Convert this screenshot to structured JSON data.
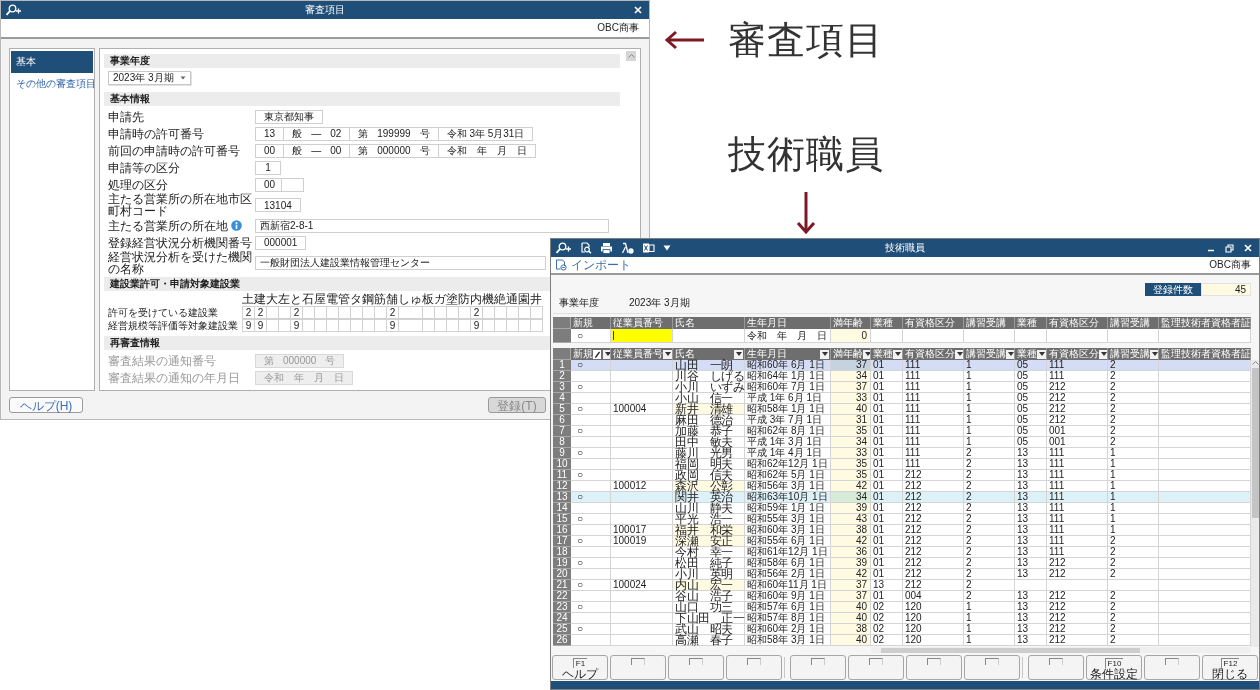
{
  "review_dialog": {
    "title": "審査項目",
    "company": "OBC商事",
    "nav": [
      {
        "label": "基本",
        "selected": true
      },
      {
        "label": "その他の審査項目",
        "selected": false
      }
    ],
    "sections": [
      {
        "kind": "year",
        "title": "事業年度",
        "value": "2023年 3月期"
      },
      {
        "kind": "form",
        "title": "基本情報",
        "disabled": false,
        "rows": [
          {
            "label": "申請先",
            "fields": [
              {
                "kind": "text",
                "parts": [
                  "東京都知事"
                ]
              }
            ]
          },
          {
            "label": "申請時の許可番号",
            "fields": [
              {
                "kind": "text",
                "parts": [
                  "13"
                ]
              },
              {
                "kind": "text",
                "parts": [
                  "般",
                  "—",
                  "02"
                ]
              },
              {
                "kind": "text",
                "parts": [
                  "第",
                  "199999",
                  "号"
                ]
              },
              {
                "kind": "text",
                "parts": [
                  "令和 3年 5月31日"
                ]
              }
            ]
          },
          {
            "label": "前回の申請時の許可番号",
            "fields": [
              {
                "kind": "text",
                "parts": [
                  "00"
                ]
              },
              {
                "kind": "text",
                "parts": [
                  "般",
                  "—",
                  "00"
                ]
              },
              {
                "kind": "text",
                "parts": [
                  "第",
                  "000000",
                  "号"
                ]
              },
              {
                "kind": "text",
                "parts": [
                  "令和　年　月　日"
                ]
              }
            ]
          },
          {
            "label": "申請等の区分",
            "fields": [
              {
                "kind": "text",
                "parts": [
                  "1"
                ]
              }
            ]
          },
          {
            "label": "処理の区分",
            "fields": [
              {
                "kind": "pair",
                "parts": [
                  "00"
                ]
              }
            ]
          },
          {
            "label": "主たる営業所の所在地市区町村コード",
            "fields": [
              {
                "kind": "text",
                "parts": [
                  "13104"
                ]
              }
            ]
          },
          {
            "label": "主たる営業所の所在地",
            "info": true,
            "fields": [
              {
                "kind": "stretch",
                "parts": [
                  "西新宿2-8-1"
                ]
              }
            ]
          },
          {
            "label": "登録経営状況分析機関番号",
            "fields": [
              {
                "kind": "text",
                "parts": [
                  "000001"
                ]
              }
            ]
          },
          {
            "label": "経営状況分析を受けた機関の名称",
            "fields": [
              {
                "kind": "stretch",
                "parts": [
                  "一般財団法人建設業情報管理センター"
                ]
              }
            ]
          }
        ]
      },
      {
        "kind": "matrix",
        "title": "建設業許可・申請対象建設業",
        "row_labels": [
          "許可を受けている建設業",
          "経営規模等評価等対象建設業"
        ],
        "columns": [
          {
            "letter": "土",
            "permitted": "2",
            "rated": "9"
          },
          {
            "letter": "建",
            "permitted": "2",
            "rated": "9"
          },
          {
            "letter": "大"
          },
          {
            "letter": "左"
          },
          {
            "letter": "と",
            "permitted": "2",
            "rated": "9"
          },
          {
            "letter": "石"
          },
          {
            "letter": "屋"
          },
          {
            "letter": "電"
          },
          {
            "letter": "管"
          },
          {
            "letter": "タ"
          },
          {
            "letter": "鋼"
          },
          {
            "letter": "筋"
          },
          {
            "letter": "舗",
            "permitted": "2",
            "rated": "9"
          },
          {
            "letter": "しゅ"
          },
          {
            "letter": "板"
          },
          {
            "letter": "ガ"
          },
          {
            "letter": "塗"
          },
          {
            "letter": "防"
          },
          {
            "letter": "内",
            "permitted": "2",
            "rated": "9"
          },
          {
            "letter": "機"
          },
          {
            "letter": "絶"
          },
          {
            "letter": "通"
          },
          {
            "letter": "園"
          },
          {
            "letter": "井"
          }
        ]
      },
      {
        "kind": "form",
        "title": "再審査情報",
        "disabled": true,
        "rows": [
          {
            "label": "審査結果の通知番号",
            "fields": [
              {
                "kind": "text",
                "parts": [
                  "第",
                  "000000",
                  "号"
                ]
              }
            ]
          },
          {
            "label": "審査結果の通知の年月日",
            "fields": [
              {
                "kind": "text",
                "parts": [
                  "令和　年　月　日"
                ]
              }
            ]
          }
        ]
      }
    ],
    "buttons": [
      {
        "label": "ヘルプ(H)",
        "disabled": false
      },
      {
        "label": "登録(T)",
        "disabled": true
      }
    ]
  },
  "staff_window": {
    "title": "技術職員",
    "import_link": "インポート",
    "company": "OBC商事",
    "count_label": "登録件数",
    "count": "45",
    "year_label": "事業年度",
    "year": "2023年 3月期",
    "entry_grid": {
      "columns": [
        "新規",
        "従業員番号",
        "氏名",
        "生年月日",
        "満年齢",
        "業種",
        "有資格区分",
        "講習受講",
        "業種",
        "有資格区分",
        "講習受講",
        "監理技術者資格者証"
      ],
      "row": {
        "new": "○",
        "birth": "令和　年　月　日",
        "age": "0"
      }
    },
    "grid": {
      "columns": [
        {
          "label": "新規",
          "editable": true,
          "filter": true
        },
        {
          "label": "従業員番号",
          "filter": true
        },
        {
          "label": "氏名",
          "filter": true
        },
        {
          "label": "生年月日",
          "filter": true
        },
        {
          "label": "満年齢",
          "filter": true
        },
        {
          "label": "業種",
          "filter": true
        },
        {
          "label": "有資格区分",
          "filter": true
        },
        {
          "label": "講習受講",
          "filter": true
        },
        {
          "label": "業種",
          "filter": true
        },
        {
          "label": "有資格区分",
          "filter": true
        },
        {
          "label": "講習受講",
          "filter": true
        },
        {
          "label": "監理技術者資格者証"
        }
      ],
      "rows": [
        {
          "no": "1",
          "cells": [
            "○",
            "",
            "山田　一朗",
            "昭和60年 6月 1日",
            "37",
            "01",
            "111",
            "1",
            "05",
            "111",
            "2"
          ],
          "selected": true,
          "highlighted": false
        },
        {
          "no": "2",
          "cells": [
            "",
            "",
            "川谷　しげる",
            "昭和64年 1月 1日",
            "34",
            "01",
            "111",
            "1",
            "05",
            "111",
            "2"
          ],
          "selected": false,
          "highlighted": false
        },
        {
          "no": "3",
          "cells": [
            "○",
            "",
            "小川　いずみ",
            "昭和60年 7月 1日",
            "37",
            "01",
            "111",
            "1",
            "05",
            "212",
            "2"
          ],
          "selected": false,
          "highlighted": false
        },
        {
          "no": "4",
          "cells": [
            "",
            "",
            "小山　信一",
            "平成 1年 6月 1日",
            "33",
            "01",
            "111",
            "1",
            "05",
            "212",
            "2"
          ],
          "selected": false,
          "highlighted": false
        },
        {
          "no": "5",
          "cells": [
            "○",
            "100004",
            "新井　清雄",
            "昭和58年 1月 1日",
            "40",
            "01",
            "111",
            "1",
            "05",
            "212",
            "2"
          ],
          "selected": false,
          "highlighted": false
        },
        {
          "no": "6",
          "cells": [
            "",
            "",
            "麻田　德治",
            "平成 3年 7月 1日",
            "31",
            "01",
            "111",
            "1",
            "05",
            "212",
            "2"
          ],
          "selected": false,
          "highlighted": false
        },
        {
          "no": "7",
          "cells": [
            "○",
            "",
            "加藤　恭子",
            "昭和62年 8月 1日",
            "35",
            "01",
            "111",
            "1",
            "05",
            "001",
            "2"
          ],
          "selected": false,
          "highlighted": false
        },
        {
          "no": "8",
          "cells": [
            "",
            "",
            "田中　敏夫",
            "平成 1年 3月 1日",
            "34",
            "01",
            "111",
            "1",
            "05",
            "001",
            "2"
          ],
          "selected": false,
          "highlighted": false
        },
        {
          "no": "9",
          "cells": [
            "○",
            "",
            "藤川　光男",
            "平成 1年 4月 1日",
            "33",
            "01",
            "111",
            "2",
            "13",
            "111",
            "1"
          ],
          "selected": false,
          "highlighted": false
        },
        {
          "no": "10",
          "cells": [
            "",
            "",
            "福岡　明夫",
            "昭和62年12月 1日",
            "35",
            "01",
            "111",
            "2",
            "13",
            "111",
            "1"
          ],
          "selected": false,
          "highlighted": false
        },
        {
          "no": "11",
          "cells": [
            "○",
            "",
            "政岡　信夫",
            "昭和62年 5月 1日",
            "35",
            "01",
            "212",
            "2",
            "13",
            "111",
            "1"
          ],
          "selected": false,
          "highlighted": false
        },
        {
          "no": "12",
          "cells": [
            "",
            "100012",
            "森沢　公彰",
            "昭和56年 3月 1日",
            "42",
            "01",
            "212",
            "2",
            "13",
            "111",
            "1"
          ],
          "selected": false,
          "highlighted": false
        },
        {
          "no": "13",
          "cells": [
            "○",
            "",
            "関井　英治",
            "昭和63年10月 1日",
            "34",
            "01",
            "212",
            "2",
            "13",
            "111",
            "1"
          ],
          "selected": false,
          "highlighted": true
        },
        {
          "no": "14",
          "cells": [
            "",
            "",
            "山川　静夫",
            "昭和59年 1月 1日",
            "39",
            "01",
            "212",
            "2",
            "13",
            "111",
            "1"
          ],
          "selected": false,
          "highlighted": false
        },
        {
          "no": "15",
          "cells": [
            "○",
            "",
            "平光　浩一",
            "昭和55年 3月 1日",
            "43",
            "01",
            "212",
            "2",
            "13",
            "111",
            "1"
          ],
          "selected": false,
          "highlighted": false
        },
        {
          "no": "16",
          "cells": [
            "",
            "100017",
            "福井　和栄",
            "昭和60年 3月 1日",
            "38",
            "01",
            "212",
            "2",
            "13",
            "111",
            "1"
          ],
          "selected": false,
          "highlighted": false
        },
        {
          "no": "17",
          "cells": [
            "○",
            "100019",
            "深瀬　安正",
            "昭和55年 6月 1日",
            "42",
            "01",
            "212",
            "2",
            "13",
            "111",
            "2"
          ],
          "selected": false,
          "highlighted": false
        },
        {
          "no": "18",
          "cells": [
            "",
            "",
            "今村　幸一",
            "昭和61年12月 1日",
            "36",
            "01",
            "212",
            "2",
            "13",
            "111",
            "2"
          ],
          "selected": false,
          "highlighted": false
        },
        {
          "no": "19",
          "cells": [
            "○",
            "",
            "松田　純子",
            "昭和58年 6月 1日",
            "39",
            "01",
            "212",
            "2",
            "13",
            "212",
            "2"
          ],
          "selected": false,
          "highlighted": false
        },
        {
          "no": "20",
          "cells": [
            "",
            "",
            "小川　英明",
            "昭和56年 2月 1日",
            "42",
            "01",
            "212",
            "2",
            "13",
            "212",
            "2"
          ],
          "selected": false,
          "highlighted": false
        },
        {
          "no": "21",
          "cells": [
            "○",
            "100024",
            "内山　宏一",
            "昭和60年11月 1日",
            "37",
            "13",
            "212",
            "2"
          ],
          "selected": false,
          "highlighted": false
        },
        {
          "no": "22",
          "cells": [
            "",
            "",
            "谷山　浩子",
            "昭和60年 9月 1日",
            "37",
            "01",
            "004",
            "2",
            "13",
            "212",
            "2"
          ],
          "selected": false,
          "highlighted": false
        },
        {
          "no": "23",
          "cells": [
            "○",
            "",
            "山口　功三",
            "昭和57年 6月 1日",
            "40",
            "02",
            "120",
            "1",
            "13",
            "212",
            "2"
          ],
          "selected": false,
          "highlighted": false
        },
        {
          "no": "24",
          "cells": [
            "",
            "",
            "下山田　正一",
            "昭和57年 8月 1日",
            "40",
            "02",
            "120",
            "1",
            "13",
            "212",
            "2"
          ],
          "selected": false,
          "highlighted": false
        },
        {
          "no": "25",
          "cells": [
            "○",
            "",
            "武山　昭夫",
            "昭和60年 2月 1日",
            "38",
            "02",
            "120",
            "1",
            "13",
            "212",
            "2"
          ],
          "selected": false,
          "highlighted": false
        },
        {
          "no": "26",
          "cells": [
            "",
            "",
            "高瀬　春子",
            "昭和58年 3月 1日",
            "40",
            "02",
            "120",
            "1",
            "13",
            "212",
            "2"
          ],
          "selected": false,
          "highlighted": false
        }
      ]
    },
    "function_keys": [
      {
        "kind": "key",
        "key": "F1",
        "label": "ヘルプ"
      },
      {
        "kind": "blank"
      },
      {
        "kind": "blank"
      },
      {
        "kind": "blank"
      },
      {
        "kind": "blank"
      },
      {
        "kind": "blank"
      },
      {
        "kind": "blank"
      },
      {
        "kind": "blank"
      },
      {
        "kind": "blank"
      },
      {
        "kind": "key",
        "key": "F10",
        "label": "条件設定"
      },
      {
        "kind": "blank"
      },
      {
        "kind": "key",
        "key": "F12",
        "label": "閉じる"
      }
    ]
  },
  "annotations": [
    {
      "kind": "left-arrow",
      "text": "審査項目"
    },
    {
      "kind": "down-arrow",
      "text": "技術職員"
    }
  ]
}
